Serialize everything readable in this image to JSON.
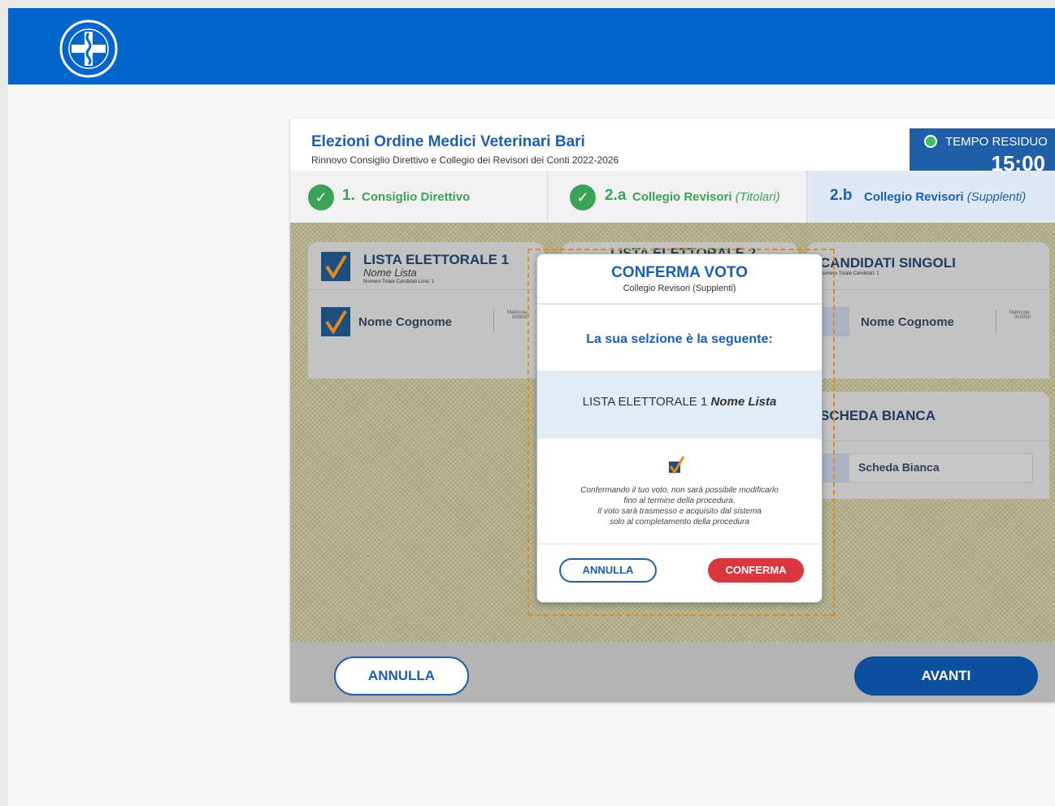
{
  "header": {
    "title": "Elezioni Ordine Medici Veterinari Bari",
    "subtitle": "Rinnovo Consiglio Direttivo e Collegio dei Revisori dei Conti 2022-2026"
  },
  "timer": {
    "label": "TEMPO RESIDUO",
    "value": "15:00"
  },
  "steps": [
    {
      "num": "1.",
      "label": "Consiglio Direttivo",
      "sub": ""
    },
    {
      "num": "2.a",
      "label": "Collegio Revisori",
      "sub": "(Titolari)"
    },
    {
      "num": "2.b",
      "label": "Collegio Revisori",
      "sub": "(Supplenti)"
    }
  ],
  "lists": {
    "list1": {
      "title": "LISTA ELETTORALE 1",
      "name": "Nome Lista",
      "count": "Numero Totale Candidati Lista: 1",
      "candidate": "Nome Cognome",
      "matricola_label": "Matricola:",
      "matricola_value": "000000"
    },
    "list2": {
      "title": "LISTA ELETTORALE 2"
    },
    "singles": {
      "title": "CANDIDATI SINGOLI",
      "count": "Numero Totale Candidati: 1",
      "candidate": "Nome Cognome",
      "matricola_label": "Matricola:",
      "matricola_value": "000000"
    },
    "blank": {
      "title": "SCHEDA BIANCA",
      "option": "Scheda Bianca"
    }
  },
  "modal": {
    "title": "CONFERMA VOTO",
    "subtitle": "Collegio Revisori (Supplenti)",
    "question": "La sua selzione è la seguente:",
    "selection_list": "LISTA ELETTORALE 1",
    "selection_name": "Nome Lista",
    "note_lines": [
      "Confermando il tuo voto, non sarà possibile modificarlo",
      "fino al termine della procedura.",
      "Il voto sarà trasmesso e acquisito dal sistema",
      "solo al completamento della procedura"
    ],
    "cancel": "ANNULLA",
    "confirm": "CONFERMA"
  },
  "footer": {
    "cancel": "ANNULLA",
    "next": "AVANTI"
  },
  "colors": {
    "brand_blue": "#0066cc",
    "confirm_red": "#d9363e",
    "check_green": "#3aa357",
    "highlight_orange": "#e28a1f"
  }
}
